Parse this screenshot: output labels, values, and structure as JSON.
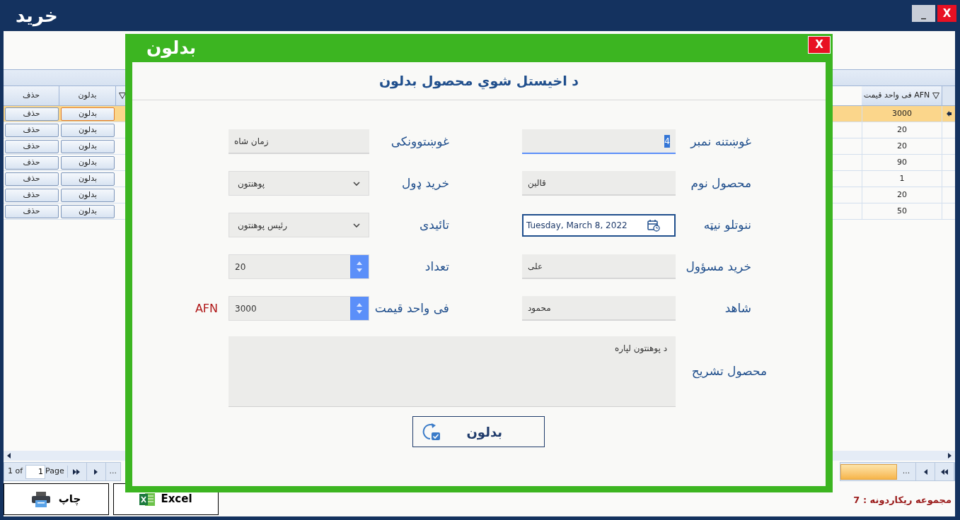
{
  "window": {
    "title": "خرید",
    "minimize": "_",
    "close": "X"
  },
  "grid": {
    "columns": [
      {
        "label": "فی واحد قیمت AFN",
        "filter": true
      },
      {
        "filter": true
      },
      {
        "label": "بدلون",
        "filter": false
      },
      {
        "label": "حذف",
        "filter": false
      }
    ],
    "rows": [
      {
        "price": "3000",
        "edit": "بدلون",
        "delete": "حذف",
        "selected": true
      },
      {
        "price": "20",
        "edit": "بدلون",
        "delete": "حذف",
        "selected": false
      },
      {
        "price": "20",
        "edit": "بدلون",
        "delete": "حذف",
        "selected": false
      },
      {
        "price": "90",
        "edit": "بدلون",
        "delete": "حذف",
        "selected": false
      },
      {
        "price": "1",
        "edit": "بدلون",
        "delete": "حذف",
        "selected": false
      },
      {
        "price": "20",
        "edit": "بدلون",
        "delete": "حذف",
        "selected": false
      },
      {
        "price": "50",
        "edit": "بدلون",
        "delete": "حذف",
        "selected": false
      }
    ]
  },
  "pager": {
    "of": "1 of",
    "page": "1",
    "page_label": "Page",
    "more_left": "...",
    "more_right": "..."
  },
  "bottom": {
    "print": "چاپ",
    "excel": "Excel",
    "record_count": "مجموعه ریکاردونه : 7"
  },
  "dialog": {
    "title": "بدلون",
    "close": "X",
    "heading": "د اخیستل شوي محصول بدلون",
    "rows": [
      {
        "right": {
          "label": "غوښتنه نمبر",
          "kind": "text",
          "value": "4",
          "focused": true
        },
        "left": {
          "label": "غوښتوونکی",
          "kind": "text",
          "value": "زمان شاه",
          "focused": false
        }
      },
      {
        "right": {
          "label": "محصول نوم",
          "kind": "text",
          "value": "قالین",
          "focused": false
        },
        "left": {
          "label": "خرید ډول",
          "kind": "select",
          "value": "پوهنتون"
        }
      },
      {
        "right": {
          "label": "ننوتلو نیټه",
          "kind": "date",
          "value": "Tuesday, March 8, 2022"
        },
        "left": {
          "label": "تائیدی",
          "kind": "select",
          "value": "رئیس پوهنتون"
        }
      },
      {
        "right": {
          "label": "خرید مسؤول",
          "kind": "text",
          "value": "علی",
          "focused": false
        },
        "left": {
          "label": "تعداد",
          "kind": "spinner",
          "value": "20"
        }
      },
      {
        "right": {
          "label": "شاهد",
          "kind": "text",
          "value": "محمود",
          "focused": false
        },
        "left": {
          "label": "فی واحد قیمت",
          "kind": "spinner",
          "value": "3000",
          "unit": "AFN"
        }
      }
    ],
    "description": {
      "label": "محصول تشریح",
      "value": "د پوهنتون لپاره"
    },
    "submit": "بدلون"
  }
}
